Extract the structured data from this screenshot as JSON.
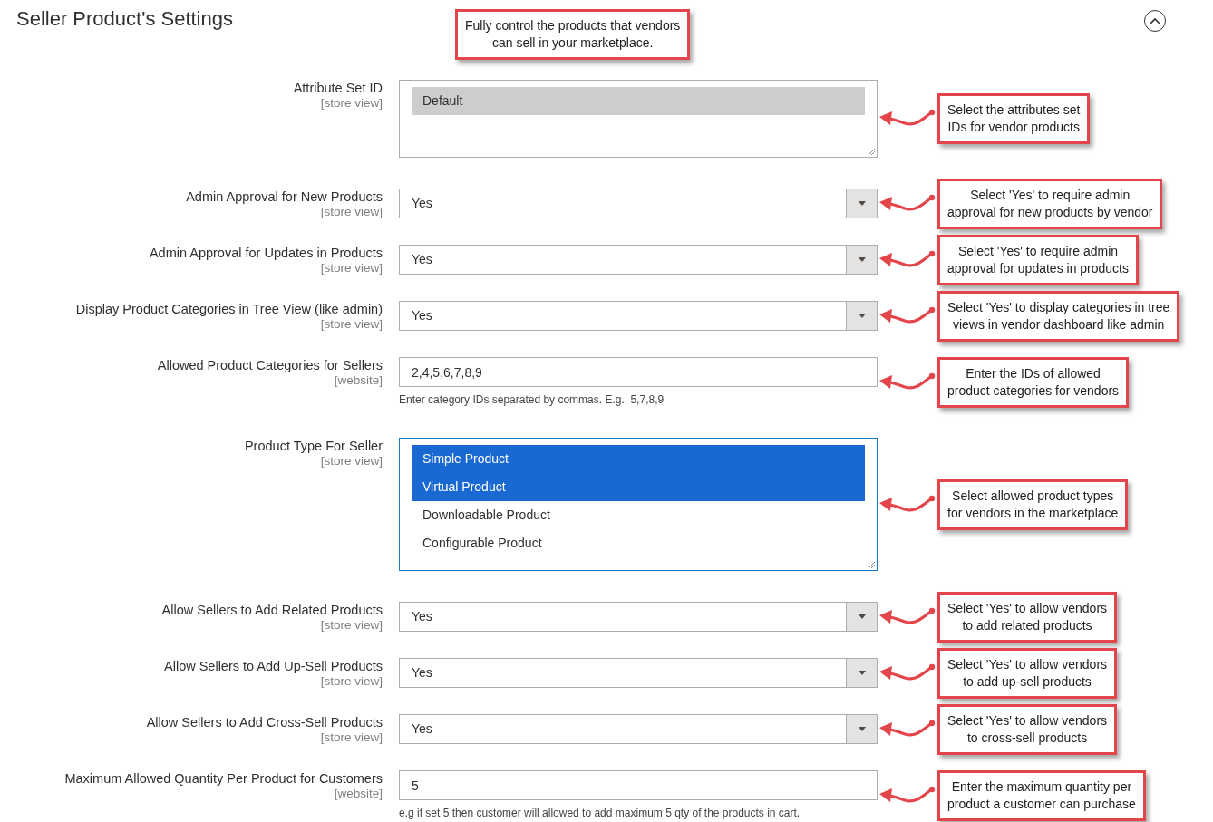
{
  "title": "Seller Product's Settings",
  "intro_callout": "Fully control the products that vendors\ncan sell in your marketplace.",
  "section": {
    "expanded": true
  },
  "fields": [
    {
      "kind": "multiselect",
      "label": "Attribute Set ID",
      "scope": "[store view]",
      "focused": false,
      "options": [
        {
          "label": "Default",
          "selected": true
        }
      ],
      "callout": "Select the attributes set\nIDs for vendor products"
    },
    {
      "kind": "select",
      "label": "Admin Approval for New Products",
      "scope": "[store view]",
      "value": "Yes",
      "callout": "Select 'Yes' to require admin\napproval for new products by vendor"
    },
    {
      "kind": "select",
      "label": "Admin Approval for Updates in Products",
      "scope": "[store view]",
      "value": "Yes",
      "callout": "Select 'Yes' to require admin\napproval for updates in products"
    },
    {
      "kind": "select",
      "label": "Display Product Categories in Tree View (like admin)",
      "scope": "[store view]",
      "value": "Yes",
      "callout": "Select 'Yes' to display categories in tree\nviews in vendor dashboard like admin"
    },
    {
      "kind": "text",
      "label": "Allowed Product Categories for Sellers",
      "scope": "[website]",
      "value": "2,4,5,6,7,8,9",
      "note": "Enter category IDs separated by commas. E.g., 5,7,8,9",
      "callout": "Enter the IDs of allowed\nproduct categories for vendors"
    },
    {
      "kind": "multiselect",
      "label": "Product Type For Seller",
      "scope": "[store view]",
      "focused": true,
      "options": [
        {
          "label": "Simple Product",
          "selected": true
        },
        {
          "label": "Virtual Product",
          "selected": true
        },
        {
          "label": "Downloadable Product",
          "selected": false
        },
        {
          "label": "Configurable Product",
          "selected": false
        }
      ],
      "callout": "Select allowed product types\nfor vendors in the marketplace"
    },
    {
      "kind": "select",
      "label": "Allow Sellers to Add Related Products",
      "scope": "[store view]",
      "value": "Yes",
      "callout": "Select 'Yes' to allow vendors\nto add related products"
    },
    {
      "kind": "select",
      "label": "Allow Sellers to Add Up-Sell Products",
      "scope": "[store view]",
      "value": "Yes",
      "callout": "Select 'Yes' to allow vendors\nto add up-sell products"
    },
    {
      "kind": "select",
      "label": "Allow Sellers to Add Cross-Sell Products",
      "scope": "[store view]",
      "value": "Yes",
      "callout": "Select 'Yes' to allow vendors\nto cross-sell products"
    },
    {
      "kind": "text",
      "label": "Maximum Allowed Quantity Per Product for Customers",
      "scope": "[website]",
      "value": "5",
      "note": "e.g if set 5 then customer will allowed to add maximum 5 qty of the products in cart.",
      "callout": "Enter the maximum quantity per\nproduct a customer can purchase"
    }
  ]
}
